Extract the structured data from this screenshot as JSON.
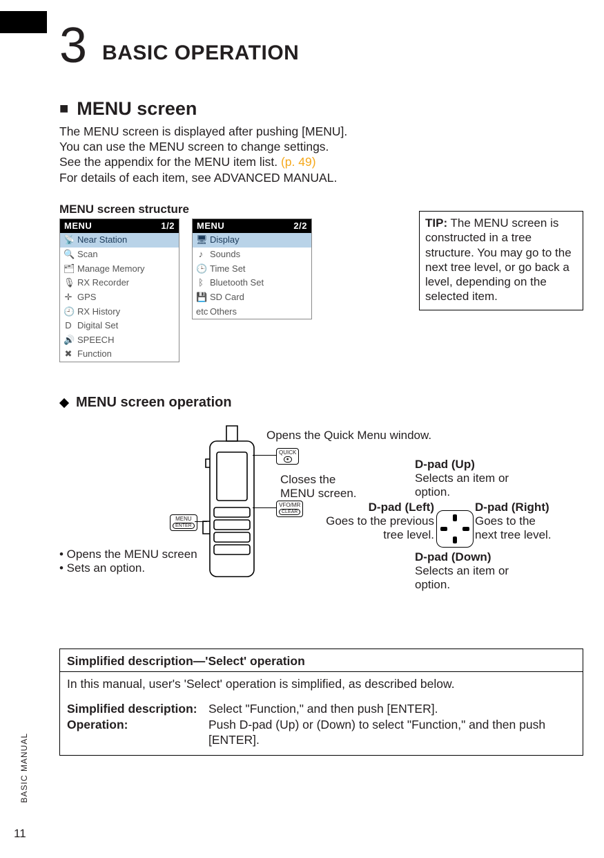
{
  "chapter": {
    "number": "3",
    "title": "BASIC OPERATION"
  },
  "section": {
    "mark": "■",
    "title": "MENU screen",
    "intro_line1": "The MENU screen is displayed after pushing [MENU].",
    "intro_line2": "You can use the MENU screen to change settings.",
    "intro_line3_a": "See the appendix for the MENU item list. ",
    "intro_line3_link": "(p. 49)",
    "intro_line4": "For details of each item, see ADVANCED MANUAL."
  },
  "menu_structure_heading": "MENU screen structure",
  "menu_screens": [
    {
      "title": "MENU",
      "page": "1/2",
      "items": [
        {
          "icon": "📡",
          "label": "Near Station",
          "selected": true
        },
        {
          "icon": "🔍",
          "label": "Scan"
        },
        {
          "icon": "🗂",
          "label": "Manage Memory"
        },
        {
          "icon": "🎙",
          "label": "RX Recorder"
        },
        {
          "icon": "✛",
          "label": "GPS"
        },
        {
          "icon": "🕘",
          "label": "RX History"
        },
        {
          "icon": "D",
          "label": "Digital Set"
        },
        {
          "icon": "🔊",
          "label": "SPEECH"
        },
        {
          "icon": "✖",
          "label": "Function"
        }
      ]
    },
    {
      "title": "MENU",
      "page": "2/2",
      "items": [
        {
          "icon": "🖥",
          "label": "Display",
          "selected": true
        },
        {
          "icon": "♪",
          "label": "Sounds"
        },
        {
          "icon": "🕒",
          "label": "Time Set"
        },
        {
          "icon": "ᛒ",
          "label": "Bluetooth Set"
        },
        {
          "icon": "💾",
          "label": "SD Card"
        },
        {
          "icon": "etc",
          "label": "Others"
        }
      ]
    }
  ],
  "tip": {
    "label": "TIP:",
    "text": " The MENU screen is constructed in a tree structure. You may go to the next tree level, or go back a level, depending on the selected item."
  },
  "subsection": {
    "title": "MENU screen operation"
  },
  "diagram": {
    "quick_label": "Opens the Quick Menu window.",
    "close_label_l1": "Closes the",
    "close_label_l2": "MENU screen.",
    "menu_enter_l1": "• Opens the MENU screen",
    "menu_enter_l2": "• Sets an option.",
    "dpad_up_title": "D-pad (Up)",
    "dpad_up_text": "Selects an item or option.",
    "dpad_down_title": "D-pad (Down)",
    "dpad_down_text": "Selects an item or option.",
    "dpad_left_title": "D-pad (Left)",
    "dpad_left_text_l1": "Goes to the previous",
    "dpad_left_text_l2": "tree level.",
    "dpad_right_title": "D-pad (Right)",
    "dpad_right_text_l1": "Goes to the",
    "dpad_right_text_l2": "next tree level.",
    "keycap_menu_top": "MENU",
    "keycap_menu_bot": "ENTER",
    "keycap_quick_top": "QUICK",
    "keycap_quick_bot": "●",
    "keycap_vfo_top": "VFO/MR",
    "keycap_vfo_bot": "CLEAR"
  },
  "desc_box": {
    "title": "Simplified description—'Select' operation",
    "intro": "In this manual, user's 'Select' operation is simplified, as described below.",
    "row1_label": "Simplified description:",
    "row1_value": "Select \"Function,\" and then push [ENTER].",
    "row2_label": "Operation:",
    "row2_value": "Push D-pad (Up) or (Down) to select \"Function,\" and then push [ENTER]."
  },
  "footer": {
    "page_number": "11",
    "side_label": "BASIC MANUAL"
  }
}
